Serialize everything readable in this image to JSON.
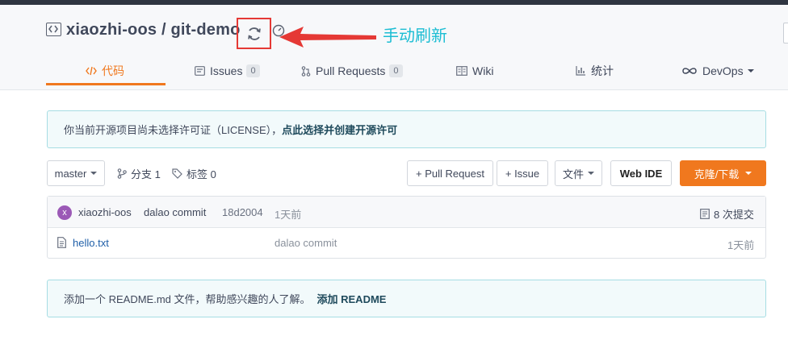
{
  "repo": {
    "owner": "xiaozhi-oos",
    "name": "git-demo",
    "full_title": "xiaozhi-oos / git-demo"
  },
  "annotation": {
    "text": "手动刷新",
    "color": "#1bbdd3",
    "arrow_color": "#e53935"
  },
  "tabs": [
    {
      "label": "代码",
      "icon": "code-icon",
      "active": true
    },
    {
      "label": "Issues",
      "icon": "issues-icon",
      "count": "0"
    },
    {
      "label": "Pull Requests",
      "icon": "pull-request-icon",
      "count": "0"
    },
    {
      "label": "Wiki",
      "icon": "wiki-icon"
    },
    {
      "label": "统计",
      "icon": "chart-icon"
    },
    {
      "label": "DevOps",
      "icon": "infinity-icon",
      "dropdown": true
    }
  ],
  "license_notice": {
    "text": "你当前开源项目尚未选择许可证（LICENSE），",
    "link": "点此选择并创建开源许可"
  },
  "toolbar": {
    "branch": "master",
    "branches_label": "分支 1",
    "tags_label": "标签 0",
    "pull_request_button": "+ Pull Request",
    "issue_button": "+ Issue",
    "file_button": "文件",
    "webide_button": "Web IDE",
    "clone_button": "克隆/下载"
  },
  "last_commit": {
    "avatar_letter": "x",
    "author": "xiaozhi-oos",
    "message": "dalao commit",
    "hash": "18d2004",
    "time": "1天前",
    "commits_label": "8 次提交"
  },
  "files": [
    {
      "name": "hello.txt",
      "message": "dalao commit",
      "time": "1天前"
    }
  ],
  "readme_notice": {
    "text": "添加一个 README.md 文件，帮助感兴趣的人了解。",
    "link": "添加 README"
  },
  "colors": {
    "accent": "#f0781e",
    "link": "#1f5fa8",
    "notice_bg": "#f2fafb",
    "notice_border": "#a6dde3"
  }
}
